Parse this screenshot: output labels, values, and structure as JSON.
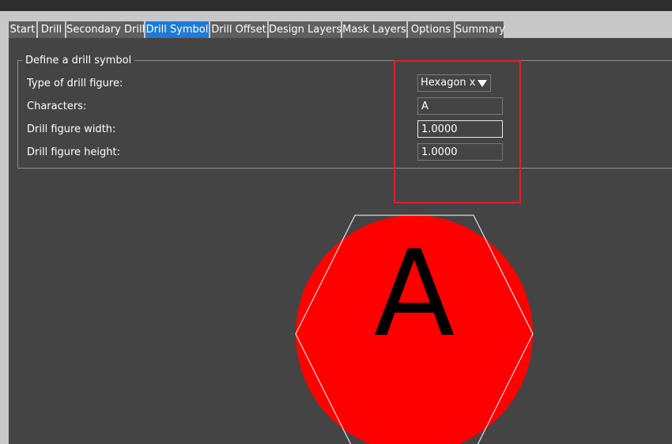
{
  "tabs": [
    {
      "label": "Start",
      "active": false
    },
    {
      "label": "Drill",
      "active": false
    },
    {
      "label": "Secondary Drill",
      "active": false
    },
    {
      "label": "Drill Symbol",
      "active": true
    },
    {
      "label": "Drill Offset",
      "active": false
    },
    {
      "label": "Design Layers",
      "active": false
    },
    {
      "label": "Mask Layers",
      "active": false
    },
    {
      "label": "Options",
      "active": false
    },
    {
      "label": "Summary",
      "active": false
    }
  ],
  "group": {
    "title": "Define a drill symbol",
    "figure_type": {
      "label": "Type of drill figure:",
      "value": "Hexagon x",
      "icon": "dropdown-arrow-icon"
    },
    "characters": {
      "label": "Characters:",
      "value": "A"
    },
    "width": {
      "label": "Drill figure width:",
      "value": "1.0000"
    },
    "height": {
      "label": "Drill figure height:",
      "value": "1.0000"
    }
  },
  "preview": {
    "character": "A",
    "fill_color": "#ff0000",
    "outline_color": "#ffffff",
    "shape": "hexagon-x"
  },
  "colors": {
    "active_tab": "#1e7ad6",
    "highlight": "#e02020",
    "panel": "#444444"
  }
}
